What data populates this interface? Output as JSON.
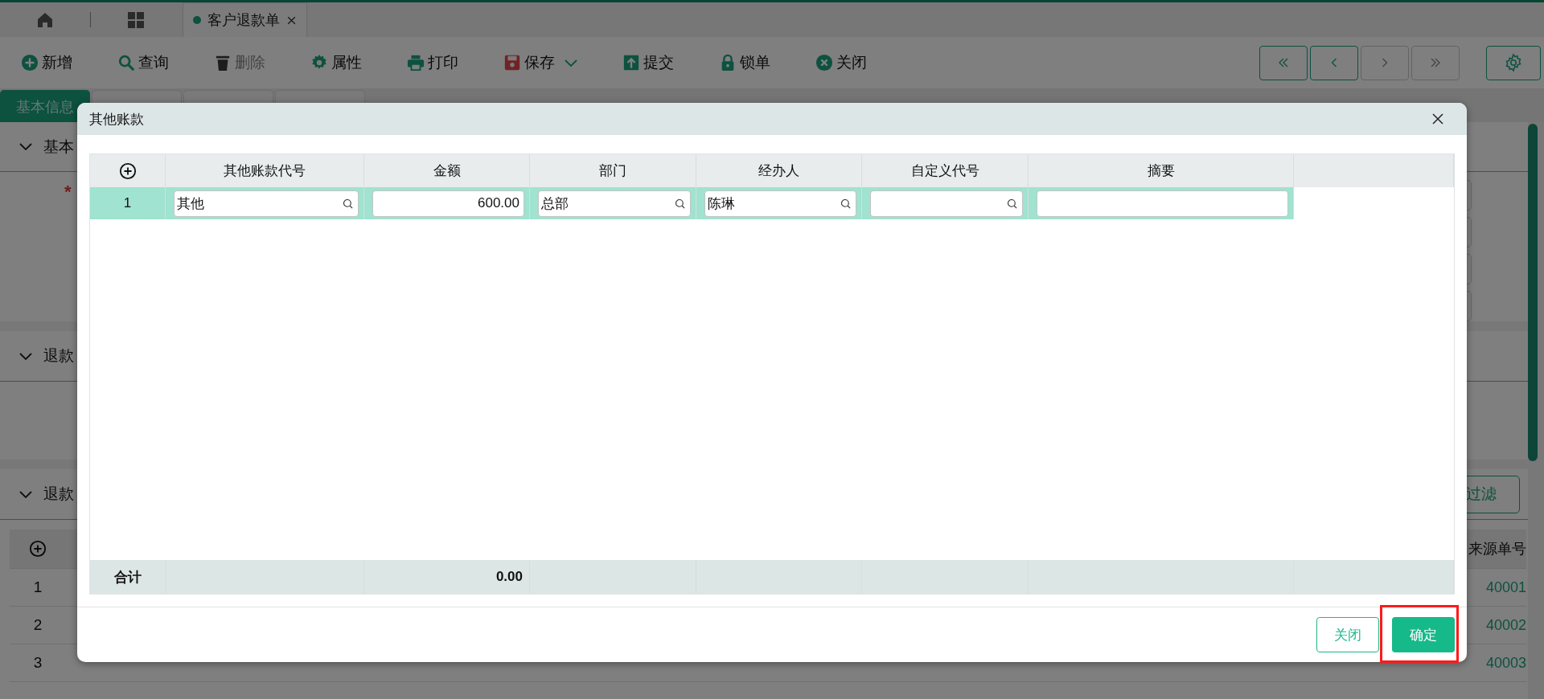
{
  "tabs": [
    {
      "label": "客户退款单",
      "selected": true
    }
  ],
  "toolbar": [
    {
      "label": "新增",
      "disabled": false
    },
    {
      "label": "查询",
      "disabled": false
    },
    {
      "label": "删除",
      "disabled": true
    },
    {
      "label": "属性",
      "disabled": false
    },
    {
      "label": "打印",
      "disabled": false
    },
    {
      "label": "保存",
      "disabled": false,
      "dropdown": true
    },
    {
      "label": "提交",
      "disabled": false
    },
    {
      "label": "锁单",
      "disabled": false
    },
    {
      "label": "关闭",
      "disabled": false
    }
  ],
  "nav_buttons": [
    {
      "disabled": false
    },
    {
      "disabled": false
    },
    {
      "disabled": true
    },
    {
      "disabled": true
    }
  ],
  "form_tabs": [
    {
      "label": "基本信息",
      "selected": true
    },
    {
      "selected": false
    },
    {
      "selected": false
    },
    {
      "selected": false
    }
  ],
  "sections": [
    {
      "title": "基本",
      "required_mark": "*"
    },
    {
      "title": "退款"
    },
    {
      "title": "退款"
    }
  ],
  "detail_table": {
    "filter_button": "过滤",
    "column": "来源单号",
    "rows": [
      {
        "number": "1",
        "source": "40001"
      },
      {
        "number": "2",
        "source": "40002"
      },
      {
        "number": "3",
        "source": "40003"
      }
    ]
  },
  "dialog": {
    "title": "其他账款",
    "columns": [
      "其他账款代号",
      "金额",
      "部门",
      "经办人",
      "自定义代号",
      "摘要"
    ],
    "rows": [
      {
        "number": "1",
        "selected": true,
        "cells": [
          {
            "kind": "lookup",
            "value": "其他"
          },
          {
            "kind": "number",
            "value": "600.00"
          },
          {
            "kind": "lookup",
            "value": "总部"
          },
          {
            "kind": "lookup",
            "value": "陈琳"
          },
          {
            "kind": "lookup"
          },
          {
            "kind": "text"
          }
        ]
      }
    ],
    "footer": {
      "label": "合计",
      "total": "0.00"
    },
    "buttons": [
      {
        "label": "关闭",
        "kind": "secondary",
        "highlighted": false
      },
      {
        "label": "确定",
        "kind": "primary",
        "highlighted": true
      }
    ]
  }
}
